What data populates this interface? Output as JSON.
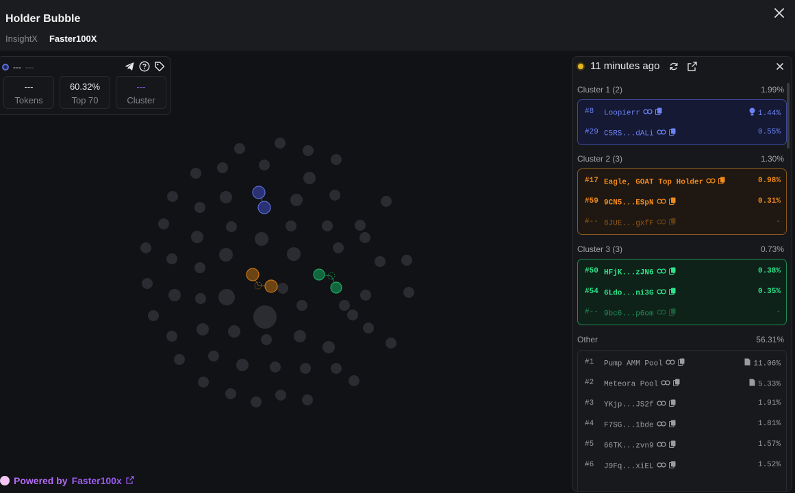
{
  "header": {
    "title": "Holder Bubble",
    "tabs": [
      {
        "label": "InsightX",
        "active": false
      },
      {
        "label": "Faster100X",
        "active": true
      }
    ]
  },
  "info_card": {
    "address": "---",
    "address_suffix": "---",
    "stats": [
      {
        "value": "---",
        "label": "Tokens"
      },
      {
        "value": "60.32%",
        "label": "Top 70"
      },
      {
        "value": "---",
        "label": "Cluster"
      }
    ]
  },
  "panel": {
    "updated": "11 minutes ago",
    "clusters": [
      {
        "label": "Cluster 1 (2)",
        "pct": "1.99%",
        "color": "#6b82f2",
        "rows": [
          {
            "rank": "#8",
            "name": "Loopierr",
            "pct": "1.44%"
          },
          {
            "rank": "#29",
            "name": "C5RS...dALi",
            "pct": "0.55%"
          }
        ]
      },
      {
        "label": "Cluster 2 (3)",
        "pct": "1.30%",
        "color": "#f08a1c",
        "rows": [
          {
            "rank": "#17",
            "name": "Eagle, GOAT Top Holder",
            "pct": "0.98%"
          },
          {
            "rank": "#59",
            "name": "9CN5...ESpN",
            "pct": "0.31%"
          },
          {
            "rank": "#--",
            "name": "8JUE...gxfF",
            "pct": "-"
          }
        ]
      },
      {
        "label": "Cluster 3 (3)",
        "pct": "0.73%",
        "color": "#2ee38a",
        "rows": [
          {
            "rank": "#50",
            "name": "HFjK...zJN6",
            "pct": "0.38%"
          },
          {
            "rank": "#54",
            "name": "6Ldo...ni3G",
            "pct": "0.35%"
          },
          {
            "rank": "#--",
            "name": "9bc6...p6om",
            "pct": "-"
          }
        ]
      }
    ],
    "other": {
      "label": "Other",
      "pct": "56.31%",
      "rows": [
        {
          "rank": "#1",
          "name": "Pump AMM Pool",
          "pct": "11.06%"
        },
        {
          "rank": "#2",
          "name": "Meteora Pool",
          "pct": "5.33%"
        },
        {
          "rank": "#3",
          "name": "YKjp...JS2f",
          "pct": "1.91%"
        },
        {
          "rank": "#4",
          "name": "F7SG...1bde",
          "pct": "1.81%"
        },
        {
          "rank": "#5",
          "name": "66TK...zvn9",
          "pct": "1.57%"
        },
        {
          "rank": "#6",
          "name": "J9Fq...xiEL",
          "pct": "1.52%"
        }
      ]
    }
  },
  "footer": {
    "prefix": "Powered by",
    "brand": "Faster100x"
  },
  "colors": {
    "cluster1": "#5b6fd6",
    "cluster2": "#c9751a",
    "cluster3": "#1fa864",
    "bubble": "#2b2c31"
  }
}
